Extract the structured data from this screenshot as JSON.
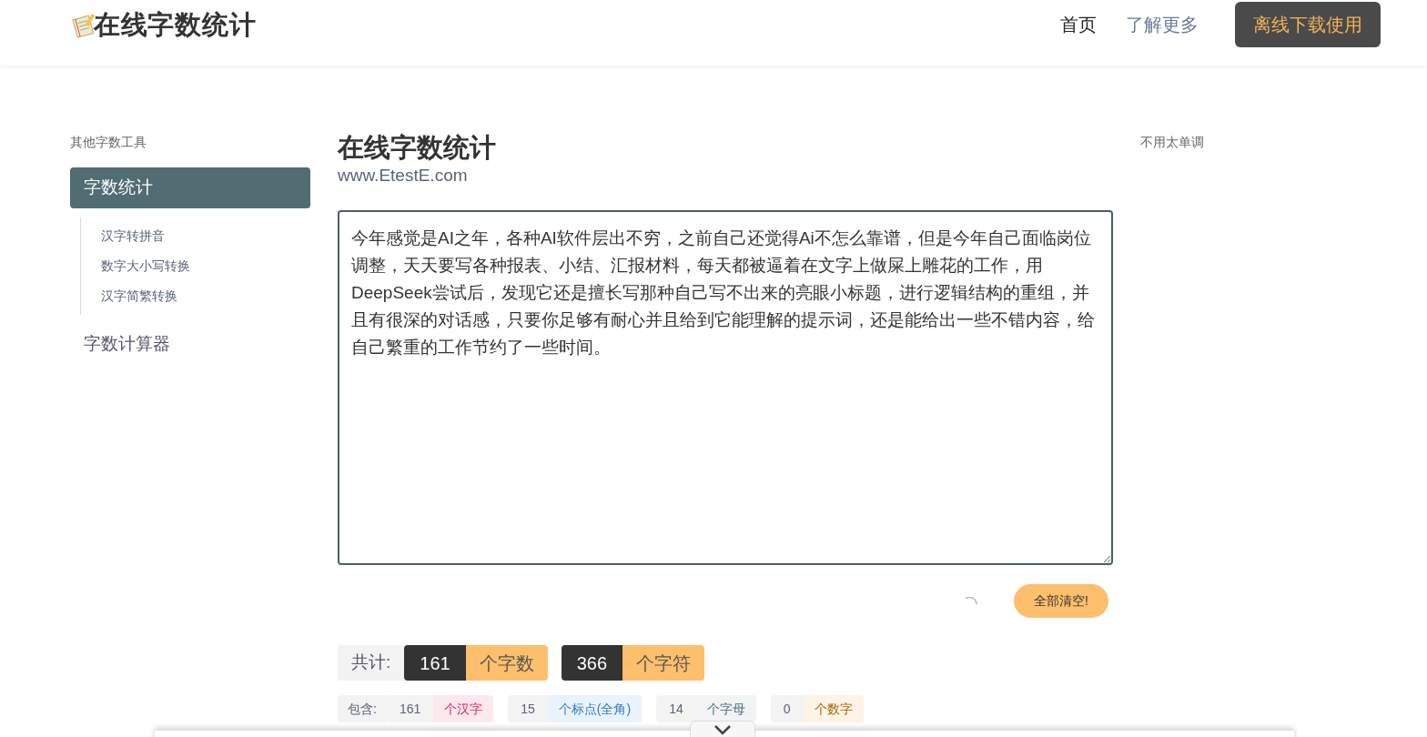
{
  "header": {
    "logo": "在线字数统计",
    "nav": [
      {
        "label": "首页",
        "selected": true
      },
      {
        "label": "了解更多",
        "selected": false
      }
    ],
    "cta": "离线下载使用"
  },
  "sidebar": {
    "title": "其他字数工具",
    "items": [
      {
        "label": "字数统计",
        "selected": true,
        "children": [
          {
            "label": "汉字转拼音",
            "selected": false
          },
          {
            "label": "数字大小写转换",
            "selected": false
          },
          {
            "label": "汉字简繁转换",
            "selected": false
          }
        ]
      },
      {
        "label": "字数计算器",
        "selected": false
      }
    ]
  },
  "main": {
    "title": "在线字数统计",
    "subtitle": "www.EtestE.com",
    "text": "今年感觉是AI之年，各种AI软件层出不穷，之前自己还觉得Ai不怎么靠谱，但是今年自己面临岗位调整，天天要写各种报表、小结、汇报材料，每天都被逼着在文字上做屎上雕花的工作，用DeepSeek尝试后，发现它还是擅长写那种自己写不出来的亮眼小标题，进行逻辑结构的重组，并且有很深的对话感，只要你足够有耐心并且给到它能理解的提示词，还是能给出一些不错内容，给自己繁重的工作节约了一些时间。",
    "clear_button": "全部清空!",
    "totals_label": "共计:",
    "totals": [
      {
        "value": "161",
        "unit": "个字数"
      },
      {
        "value": "366",
        "unit": "个字符"
      }
    ],
    "breakdown_label": "包含:",
    "breakdown": [
      {
        "value": "161",
        "unit": "个汉字",
        "color": "#e0245e"
      },
      {
        "value": "15",
        "unit": "个标点(全角)",
        "color": "#2f7bbf"
      },
      {
        "value": "14",
        "unit": "个字母",
        "color": "#4a6f7a"
      },
      {
        "value": "0",
        "unit": "个数字",
        "color": "#a0620a"
      }
    ]
  },
  "aside": {
    "text": "不用太单调"
  }
}
